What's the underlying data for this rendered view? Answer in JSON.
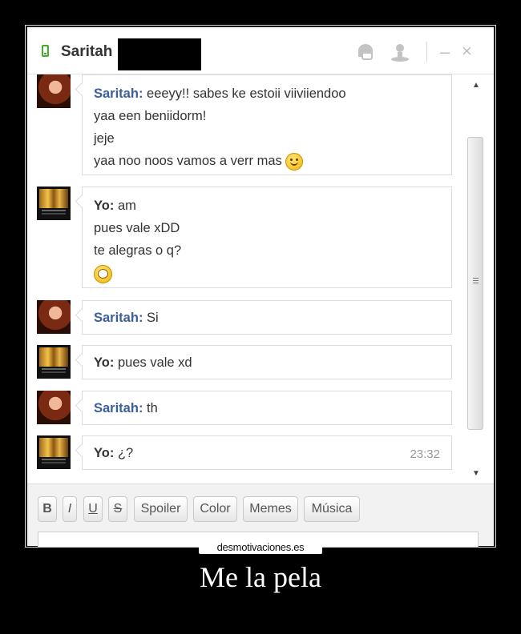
{
  "header": {
    "status_icon": "mobile-phone-icon",
    "contact_name": "Saritah",
    "actions": [
      "video-call-icon",
      "add-user-icon",
      "minimize-icon",
      "close-icon"
    ]
  },
  "messages": [
    {
      "sender": "Saritah",
      "lines": [
        "eeeyy!! sabes ke estoii viiviiendoo",
        "yaa een beniidorm!",
        "jeje",
        "yaa noo noos vamos a verr mas"
      ],
      "emoticon": "smiley"
    },
    {
      "sender": "Yo",
      "lines": [
        "am",
        "pues vale xDD",
        "te alegras o q?"
      ],
      "emoticon": "grin"
    },
    {
      "sender": "Saritah",
      "lines": [
        "Si"
      ]
    },
    {
      "sender": "Yo",
      "lines": [
        "pues vale xd"
      ]
    },
    {
      "sender": "Saritah",
      "lines": [
        "th"
      ]
    },
    {
      "sender": "Yo",
      "lines": [
        "¿?"
      ],
      "time": "23:32"
    }
  ],
  "toolbar": {
    "bold": "B",
    "italic": "I",
    "underline": "U",
    "strike": "S",
    "spoiler": "Spoiler",
    "color": "Color",
    "memes": "Memes",
    "musica": "Música"
  },
  "watermark": "desmotivaciones.es",
  "caption": "Me la pela"
}
